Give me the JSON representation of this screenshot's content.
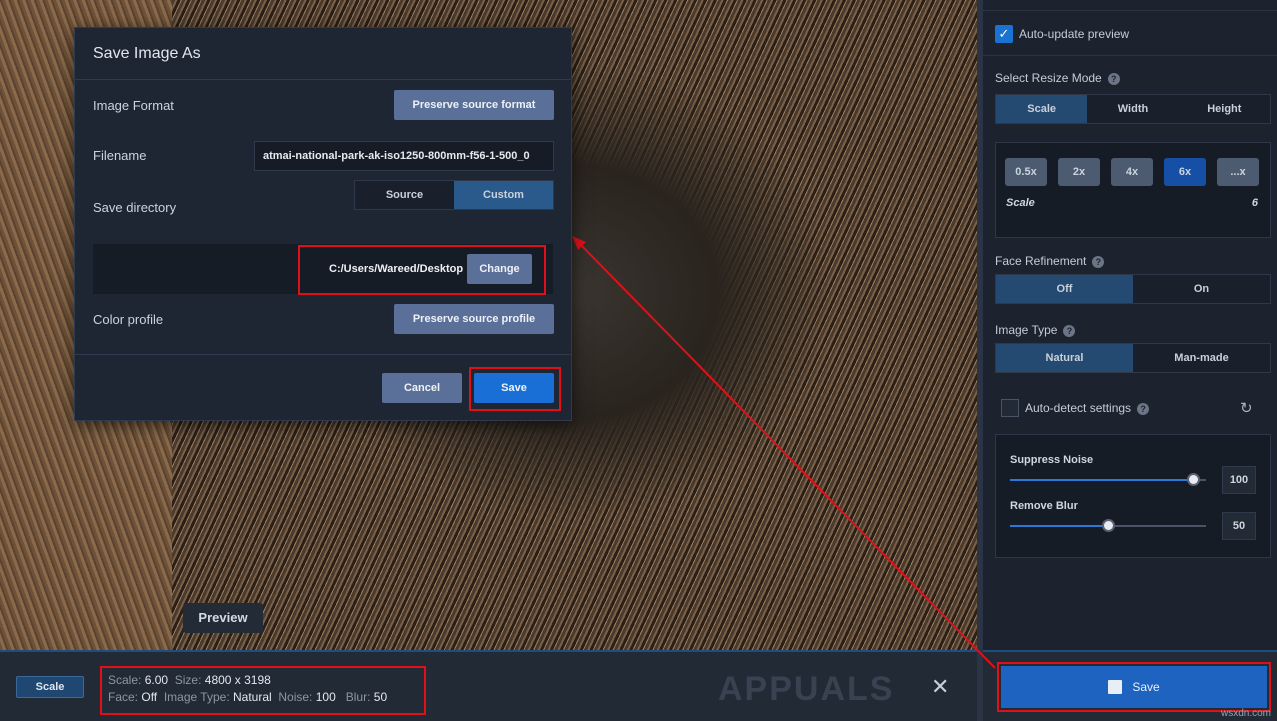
{
  "dialog": {
    "title": "Save Image As",
    "image_format_label": "Image Format",
    "image_format_value": "Preserve source format",
    "filename_label": "Filename",
    "filename_value": "atmai-national-park-ak-iso1250-800mm-f56-1-500_0",
    "save_directory_label": "Save directory",
    "dir_options": [
      "Source",
      "Custom"
    ],
    "dir_selected": "Custom",
    "directory_path": "C:/Users/Wareed/Desktop",
    "change_label": "Change",
    "color_profile_label": "Color profile",
    "color_profile_value": "Preserve source profile",
    "cancel_label": "Cancel",
    "save_label": "Save"
  },
  "preview_label": "Preview",
  "panel": {
    "auto_update_label": "Auto-update preview",
    "auto_update_checked": true,
    "resize_mode_label": "Select Resize Mode",
    "resize_modes": [
      "Scale",
      "Width",
      "Height"
    ],
    "resize_selected": "Scale",
    "scale_options": [
      "0.5x",
      "2x",
      "4x",
      "6x",
      "...x"
    ],
    "scale_selected": "6x",
    "scale_label": "Scale",
    "scale_value": "6",
    "face_label": "Face Refinement",
    "face_options": [
      "Off",
      "On"
    ],
    "face_selected": "Off",
    "image_type_label": "Image Type",
    "image_type_options": [
      "Natural",
      "Man-made"
    ],
    "image_type_selected": "Natural",
    "auto_detect_label": "Auto-detect settings",
    "auto_detect_checked": false,
    "suppress_noise_label": "Suppress Noise",
    "suppress_noise_value": "100",
    "remove_blur_label": "Remove Blur",
    "remove_blur_value": "50",
    "save_label": "Save"
  },
  "bottom": {
    "scale_button": "Scale",
    "scale_k": "Scale:",
    "scale_v": "6.00",
    "size_k": "Size:",
    "size_v": "4800 x 3198",
    "face_k": "Face:",
    "face_v": "Off",
    "type_k": "Image Type:",
    "type_v": "Natural",
    "noise_k": "Noise:",
    "noise_v": "100",
    "blur_k": "Blur:",
    "blur_v": "50"
  },
  "watermark": "APPUALS",
  "site": "wsxdn.com",
  "colors": {
    "accent": "#1650a6",
    "highlight": "#e0101a"
  }
}
